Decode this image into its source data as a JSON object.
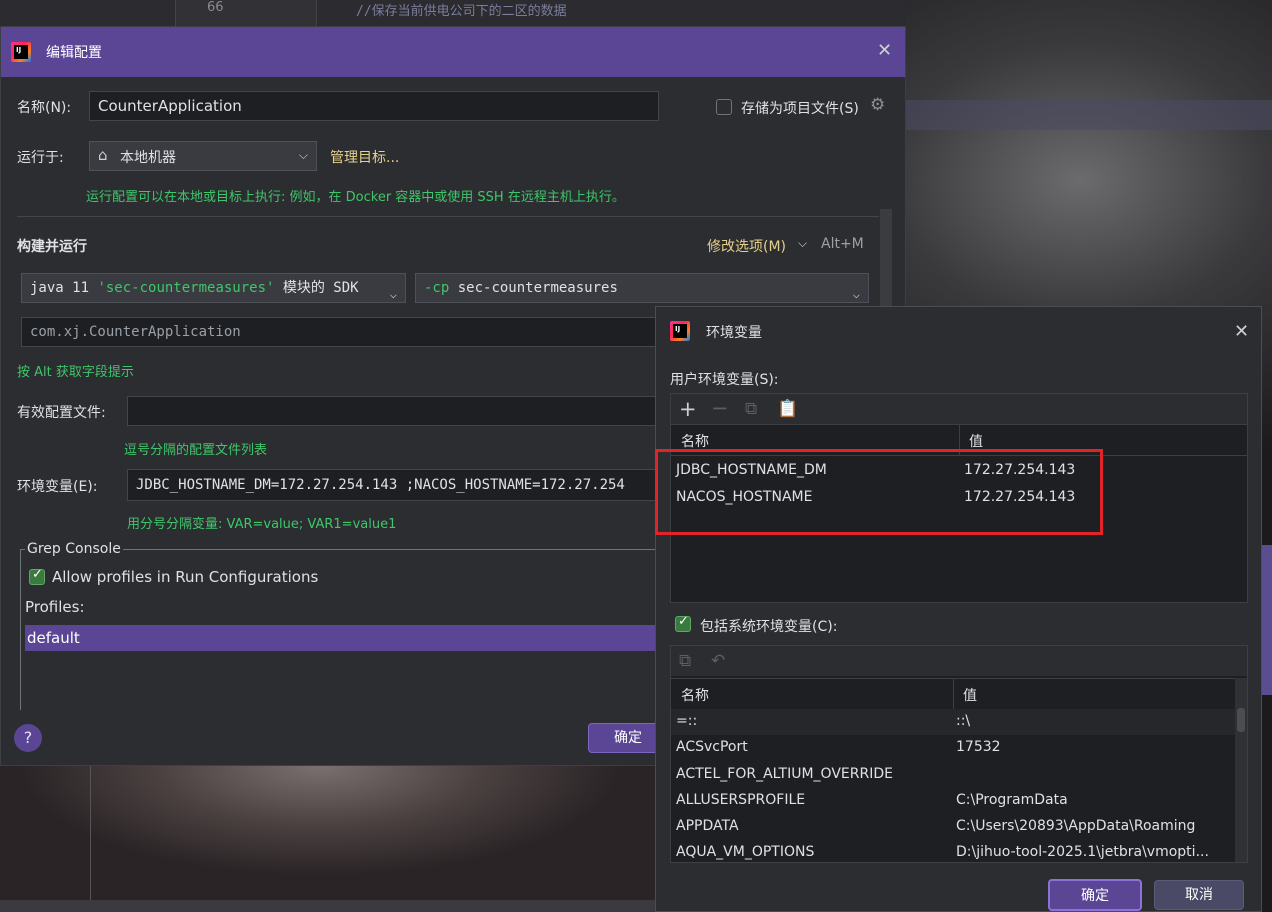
{
  "background_editor": {
    "line_number": "66",
    "comment": "//保存当前供电公司下的二区的数据"
  },
  "run_config_dialog": {
    "title": "编辑配置",
    "name_label": "名称(N):",
    "name_value": "CounterApplication",
    "store_as_project_file": "存储为项目文件(S)",
    "run_on_label": "运行于:",
    "run_on_value": "本地机器",
    "manage_targets": "管理目标...",
    "run_on_hint": "运行配置可以在本地或目标上执行: 例如，在 Docker 容器中或使用 SSH 在远程主机上执行。",
    "section_build_run": "构建并运行",
    "modify_options": "修改选项(M)",
    "modify_shortcut": "Alt+M",
    "sdk_prefix": "java 11 ",
    "sdk_module": "'sec-countermeasures'",
    "sdk_suffix": " 模块的 SDK",
    "cp_flag": "-cp",
    "cp_value": " sec-countermeasures",
    "main_class": "com.xj.CounterApplication",
    "alt_hint": "按 Alt 获取字段提示",
    "active_profiles_label": "有效配置文件:",
    "active_profiles_hint": "逗号分隔的配置文件列表",
    "env_label": "环境变量(E):",
    "env_value": "JDBC_HOSTNAME_DM=172.27.254.143 ;NACOS_HOSTNAME=172.27.254",
    "env_hint": "用分号分隔变量: VAR=value; VAR1=value1",
    "grep_console_title": "Grep Console",
    "allow_profiles": "Allow profiles in Run Configurations",
    "profiles_label": "Profiles:",
    "profile_default": "default",
    "help_icon": "?",
    "ok_button": "确定"
  },
  "env_dialog": {
    "title": "环境变量",
    "user_vars_label": "用户环境变量(S):",
    "col_name": "名称",
    "col_value": "值",
    "user_vars": [
      {
        "name": "JDBC_HOSTNAME_DM",
        "value": "172.27.254.143"
      },
      {
        "name": "NACOS_HOSTNAME",
        "value": "172.27.254.143"
      }
    ],
    "include_system": "包括系统环境变量(C):",
    "system_vars": [
      {
        "name": "=::",
        "value": "::\\"
      },
      {
        "name": "ACSvcPort",
        "value": "17532"
      },
      {
        "name": "ACTEL_FOR_ALTIUM_OVERRIDE",
        "value": ""
      },
      {
        "name": "ALLUSERSPROFILE",
        "value": "C:\\ProgramData"
      },
      {
        "name": "APPDATA",
        "value": "C:\\Users\\20893\\AppData\\Roaming"
      },
      {
        "name": "AQUA_VM_OPTIONS",
        "value": "D:\\jihuo-tool-2025.1\\jetbra\\vmopti..."
      }
    ],
    "ok_button": "确定",
    "cancel_button": "取消"
  },
  "colors": {
    "accent": "#5b4696",
    "hint_green": "#3fc66a",
    "highlight_red": "#e0242a"
  }
}
